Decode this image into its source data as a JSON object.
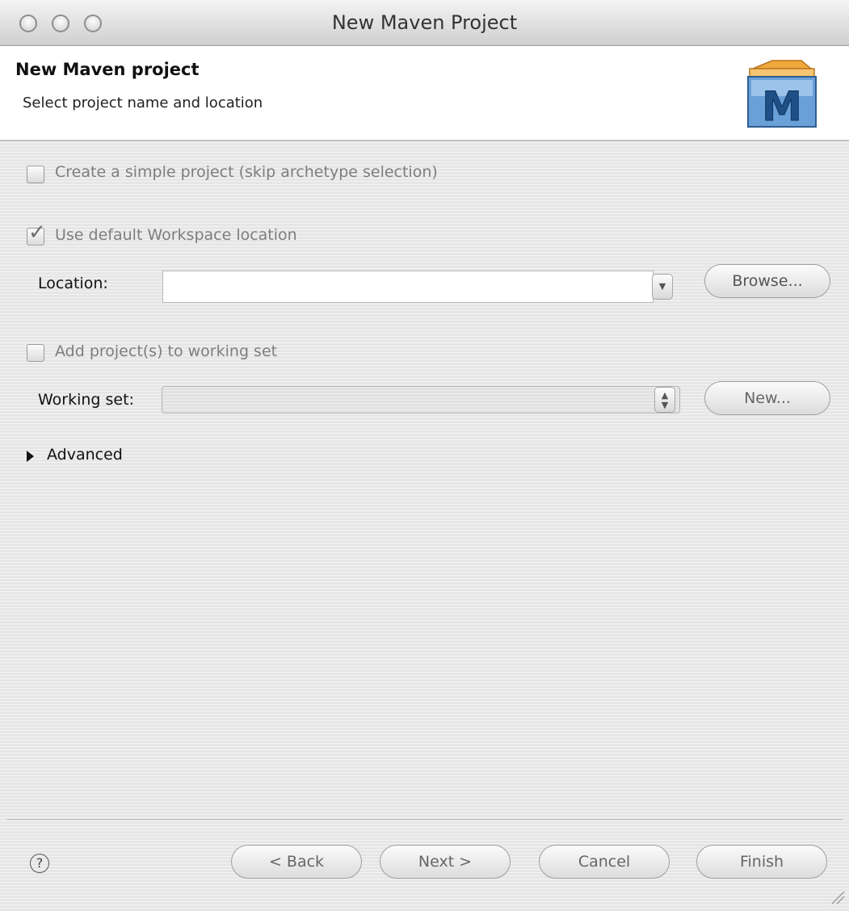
{
  "window": {
    "title": "New Maven Project"
  },
  "header": {
    "title": "New Maven project",
    "subtitle": "Select project name and location",
    "logo_letter": "M",
    "logo_icon": "maven-folder-icon"
  },
  "options": {
    "simple_project": {
      "label": "Create a simple project (skip archetype selection)",
      "checked": false
    },
    "default_location": {
      "label": "Use default Workspace location",
      "checked": true,
      "check_glyph": "✓"
    },
    "location": {
      "label": "Location:",
      "value": "",
      "button": "Browse..."
    },
    "working_set_toggle": {
      "label": "Add project(s) to working set",
      "checked": false
    },
    "working_set": {
      "label": "Working set:",
      "value": "",
      "button": "New..."
    },
    "advanced": {
      "label": "Advanced",
      "expanded": false
    }
  },
  "footer": {
    "help_glyph": "?",
    "back": "< Back",
    "next": "Next >",
    "cancel": "Cancel",
    "finish": "Finish"
  },
  "colors": {
    "panel_bg": "#e6e6e6",
    "header_bg": "#ffffff",
    "logo_blue": "#4f8bc9",
    "logo_orange": "#f0a83c"
  }
}
